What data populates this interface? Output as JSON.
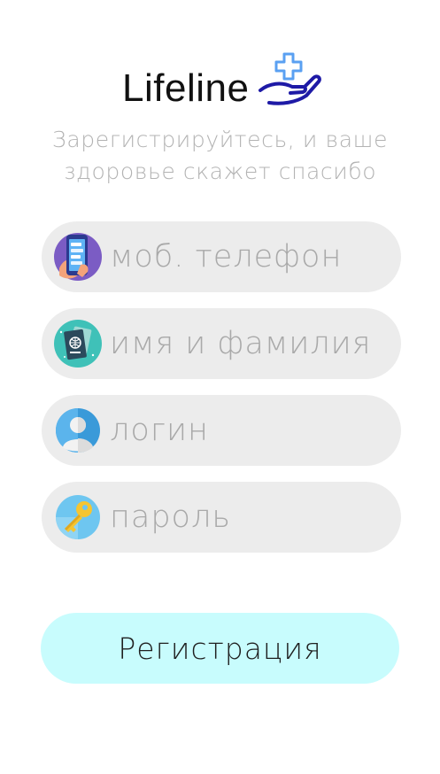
{
  "app": {
    "name": "Lifeline"
  },
  "subtitle": {
    "line1": "Зарегистрируйтесь, и ваше",
    "line2": "здоровье скажет спасибо"
  },
  "form": {
    "fields": [
      {
        "placeholder": "моб. телефон",
        "icon": "phone-icon"
      },
      {
        "placeholder": "имя и фамилия",
        "icon": "passport-icon"
      },
      {
        "placeholder": "логин",
        "icon": "user-icon"
      },
      {
        "placeholder": "пароль",
        "icon": "key-icon"
      }
    ],
    "submit_label": "Регистрация"
  },
  "colors": {
    "brand_blue": "#1e1aa6",
    "cross_blue": "#5aa0f2",
    "field_bg": "#ececec",
    "placeholder": "#a9a9a9",
    "subtitle": "#b3b3b3",
    "button_bg": "#c8fcfd"
  }
}
